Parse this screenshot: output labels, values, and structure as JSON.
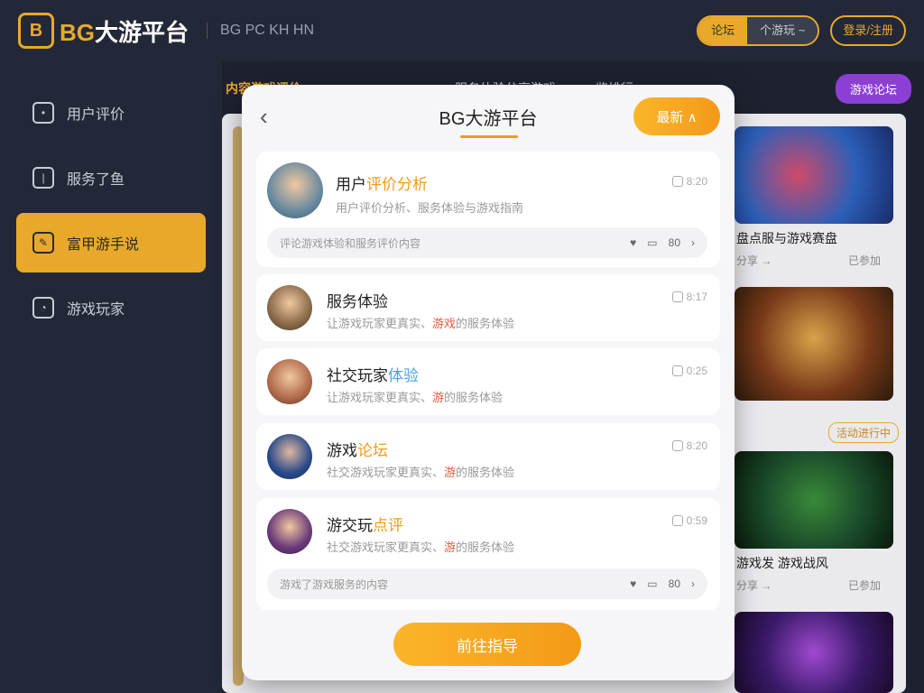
{
  "header": {
    "logo_mark": "B",
    "logo_prefix": "BG",
    "logo_text": "大游平台",
    "subtitle": "BG PC KH HN",
    "toggle_on": "论坛",
    "toggle_off": "个游玩 ~",
    "outline_btn": "登录/注册"
  },
  "sidebar": {
    "items": [
      {
        "label": "用户评价",
        "active": false
      },
      {
        "label": "服务了鱼",
        "active": false
      },
      {
        "label": "富甲游手说",
        "active": true
      },
      {
        "label": "游戏玩家",
        "active": false
      }
    ]
  },
  "background": {
    "section_title": "内容游戏评价",
    "mid_label": "服务体验分享游戏",
    "right_label": "一览排行",
    "purple_btn": "游戏论坛",
    "cards": [
      {
        "caption": "盘点服与游戏赛盘",
        "meta_left": "分享 →",
        "meta_right": "已参加"
      },
      {
        "caption": "",
        "meta_left": "",
        "meta_right": ""
      },
      {
        "caption": "游戏发 游戏战风",
        "meta_left": "分享 →",
        "meta_right": "已参加"
      },
      {
        "caption": "",
        "meta_left": "",
        "meta_right": ""
      }
    ],
    "badge": "活动进行中"
  },
  "modal": {
    "back_icon": "‹",
    "title": "BG大游平台",
    "pill": "最新 ∧",
    "entries": [
      {
        "title_plain": "用户",
        "title_accent": "评价分析",
        "sub": "用户评价分析、服务体验与游戏指南",
        "time": "8:20",
        "strip": "评论游戏体验和服务评价内容"
      },
      {
        "title_plain": "服务体验",
        "title_accent": "",
        "sub_a": "让游戏玩家更真实、",
        "sub_red": "游戏",
        "sub_b": "的服务体验",
        "time": "8:17"
      },
      {
        "title_plain": "社交玩家",
        "title_accent": "体验",
        "sub_a": "让游戏玩家更真实、",
        "sub_red": "游",
        "sub_b": "的服务体验",
        "time": "0:25"
      },
      {
        "title_plain": "游戏",
        "title_accent": "论坛",
        "sub_a": "社交游戏玩家更真实、",
        "sub_red": "游",
        "sub_b": "的服务体验",
        "time": "8:20"
      },
      {
        "title_plain": "游交玩",
        "title_accent": "点评",
        "sub_a": "社交游戏玩家更真实、",
        "sub_red": "游",
        "sub_b": "的服务体验",
        "time": "0:59",
        "strip": "游戏了游戏服务的内容"
      }
    ],
    "strip_count": "80",
    "cta": "前往指导"
  },
  "colors": {
    "accent": "#e8a92a",
    "orange": "#f39a18",
    "dark_bg": "#1e2230",
    "purple": "#8b3fd4"
  }
}
